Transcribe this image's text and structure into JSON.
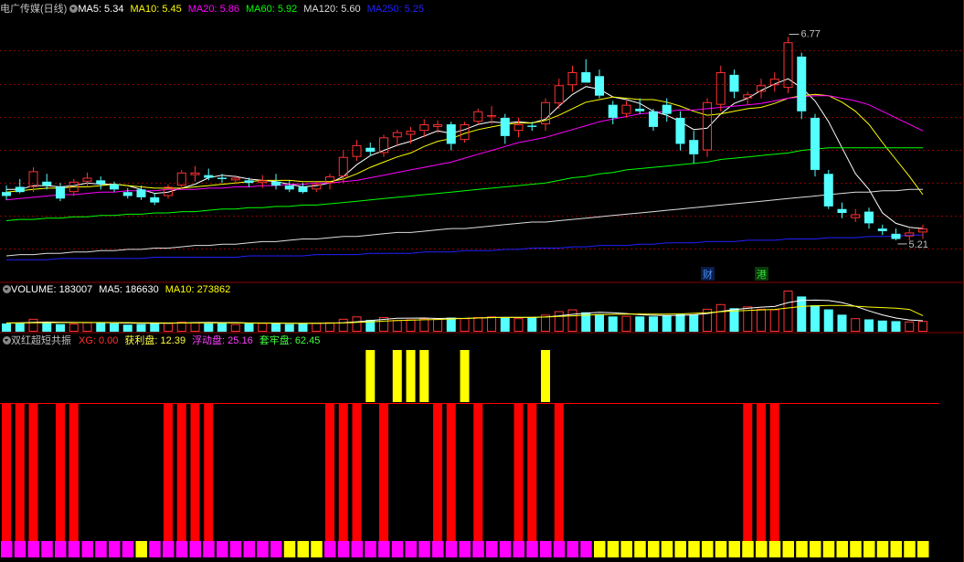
{
  "colors": {
    "up": "#ff3232",
    "down": "#54ffff",
    "ma5": "#ffffff",
    "ma10": "#ffff00",
    "ma20": "#ff00ff",
    "ma60": "#00ff00",
    "ma120": "#dddddd",
    "ma250": "#2020ff",
    "vol_ma5": "#ffffff",
    "vol_ma10": "#ffff00",
    "bar_red": "#ff0000",
    "bar_yellow": "#ffff00",
    "bar_magenta": "#ff00ff",
    "grid": "#8b0000",
    "label": "#c0c0c0"
  },
  "price_panel": {
    "stock_title": "电广传媒(日线)",
    "ma_labels": [
      {
        "name": "MA5",
        "value": "5.34",
        "color": "#ffffff"
      },
      {
        "name": "MA10",
        "value": "5.45",
        "color": "#ffff00"
      },
      {
        "name": "MA20",
        "value": "5.86",
        "color": "#ff00ff"
      },
      {
        "name": "MA60",
        "value": "5.92",
        "color": "#00ff00"
      },
      {
        "name": "MA120",
        "value": "5.60",
        "color": "#dddddd"
      },
      {
        "name": "MA250",
        "value": "5.25",
        "color": "#2020ff"
      }
    ],
    "high_label": "6.77",
    "low_label": "5.21",
    "event_tags": [
      {
        "text": "财",
        "color": "#4a8ff0",
        "bg": "#0a1d4a",
        "index": 52
      },
      {
        "text": "港",
        "color": "#30e030",
        "bg": "#0a3a0a",
        "index": 56
      }
    ]
  },
  "volume_panel": {
    "labels": [
      {
        "name": "VOLUME",
        "value": "183007",
        "color": "#ffffff"
      },
      {
        "name": "MA5",
        "value": "186630",
        "color": "#ffffff"
      },
      {
        "name": "MA10",
        "value": "273862",
        "color": "#ffff00"
      }
    ]
  },
  "indicator_panel": {
    "title": "双红超短共振",
    "labels": [
      {
        "name": "XG",
        "value": "0.00",
        "color": "#ff3030"
      },
      {
        "name": "获利盘",
        "value": "12.39",
        "color": "#ffff40"
      },
      {
        "name": "浮动盘",
        "value": "25.16",
        "color": "#ff40ff"
      },
      {
        "name": "套牢盘",
        "value": "62.45",
        "color": "#40ff40"
      }
    ]
  },
  "chart_data": {
    "type": "candlestick",
    "price_range": [
      4.95,
      6.9
    ],
    "candles": [
      [
        5.58,
        5.63,
        5.52,
        5.55
      ],
      [
        5.62,
        5.68,
        5.57,
        5.58
      ],
      [
        5.62,
        5.77,
        5.58,
        5.74
      ],
      [
        5.66,
        5.72,
        5.6,
        5.63
      ],
      [
        5.62,
        5.65,
        5.51,
        5.53
      ],
      [
        5.58,
        5.68,
        5.55,
        5.66
      ],
      [
        5.66,
        5.73,
        5.62,
        5.69
      ],
      [
        5.67,
        5.7,
        5.6,
        5.64
      ],
      [
        5.64,
        5.66,
        5.58,
        5.6
      ],
      [
        5.58,
        5.61,
        5.53,
        5.55
      ],
      [
        5.6,
        5.63,
        5.52,
        5.54
      ],
      [
        5.54,
        5.57,
        5.48,
        5.5
      ],
      [
        5.55,
        5.64,
        5.53,
        5.62
      ],
      [
        5.63,
        5.75,
        5.6,
        5.73
      ],
      [
        5.71,
        5.78,
        5.66,
        5.73
      ],
      [
        5.71,
        5.76,
        5.67,
        5.69
      ],
      [
        5.69,
        5.72,
        5.65,
        5.68
      ],
      [
        5.67,
        5.71,
        5.64,
        5.69
      ],
      [
        5.67,
        5.69,
        5.62,
        5.65
      ],
      [
        5.65,
        5.71,
        5.61,
        5.67
      ],
      [
        5.66,
        5.72,
        5.6,
        5.63
      ],
      [
        5.63,
        5.67,
        5.58,
        5.6
      ],
      [
        5.62,
        5.65,
        5.57,
        5.58
      ],
      [
        5.6,
        5.66,
        5.58,
        5.64
      ],
      [
        5.65,
        5.72,
        5.6,
        5.7
      ],
      [
        5.7,
        5.9,
        5.65,
        5.85
      ],
      [
        5.85,
        5.98,
        5.82,
        5.94
      ],
      [
        5.92,
        5.96,
        5.86,
        5.89
      ],
      [
        5.88,
        6.02,
        5.85,
        6.0
      ],
      [
        6.0,
        6.06,
        5.93,
        6.04
      ],
      [
        6.02,
        6.08,
        5.95,
        6.05
      ],
      [
        6.05,
        6.14,
        6.0,
        6.1
      ],
      [
        6.08,
        6.13,
        6.03,
        6.1
      ],
      [
        6.1,
        6.12,
        5.9,
        5.95
      ],
      [
        5.98,
        6.12,
        5.96,
        6.1
      ],
      [
        6.12,
        6.22,
        6.1,
        6.2
      ],
      [
        6.16,
        6.24,
        6.1,
        6.17
      ],
      [
        6.15,
        6.18,
        5.95,
        6.01
      ],
      [
        6.05,
        6.15,
        6.0,
        6.1
      ],
      [
        6.09,
        6.12,
        6.05,
        6.08
      ],
      [
        6.1,
        6.3,
        6.05,
        6.27
      ],
      [
        6.26,
        6.45,
        6.22,
        6.4
      ],
      [
        6.4,
        6.55,
        6.35,
        6.5
      ],
      [
        6.5,
        6.6,
        6.42,
        6.42
      ],
      [
        6.47,
        6.52,
        6.3,
        6.32
      ],
      [
        6.25,
        6.28,
        6.1,
        6.15
      ],
      [
        6.18,
        6.28,
        6.15,
        6.25
      ],
      [
        6.22,
        6.3,
        6.18,
        6.2
      ],
      [
        6.2,
        6.22,
        6.05,
        6.08
      ],
      [
        6.25,
        6.3,
        6.12,
        6.18
      ],
      [
        6.15,
        6.2,
        5.9,
        5.95
      ],
      [
        5.98,
        6.05,
        5.8,
        5.87
      ],
      [
        5.9,
        6.3,
        5.85,
        6.27
      ],
      [
        6.25,
        6.55,
        6.2,
        6.5
      ],
      [
        6.48,
        6.52,
        6.3,
        6.35
      ],
      [
        6.3,
        6.35,
        6.25,
        6.33
      ],
      [
        6.35,
        6.45,
        6.3,
        6.4
      ],
      [
        6.4,
        6.5,
        6.35,
        6.45
      ],
      [
        6.38,
        6.77,
        6.34,
        6.73
      ],
      [
        6.62,
        6.65,
        6.14,
        6.2
      ],
      [
        6.15,
        6.18,
        5.7,
        5.75
      ],
      [
        5.72,
        5.75,
        5.45,
        5.47
      ],
      [
        5.45,
        5.5,
        5.38,
        5.42
      ],
      [
        5.38,
        5.45,
        5.35,
        5.41
      ],
      [
        5.43,
        5.46,
        5.3,
        5.34
      ],
      [
        5.3,
        5.33,
        5.25,
        5.28
      ],
      [
        5.26,
        5.3,
        5.21,
        5.22
      ],
      [
        5.24,
        5.3,
        5.21,
        5.27
      ],
      [
        5.27,
        5.33,
        5.22,
        5.3
      ]
    ],
    "ma": {
      "MA5": [
        5.6,
        5.6,
        5.63,
        5.63,
        5.62,
        5.63,
        5.65,
        5.64,
        5.64,
        5.63,
        5.6,
        5.57,
        5.58,
        5.61,
        5.64,
        5.69,
        5.71,
        5.7,
        5.68,
        5.67,
        5.66,
        5.64,
        5.62,
        5.63,
        5.65,
        5.7,
        5.79,
        5.86,
        5.9,
        5.94,
        5.97,
        6.01,
        6.05,
        6.03,
        6.06,
        6.1,
        6.12,
        6.11,
        6.12,
        6.11,
        6.14,
        6.24,
        6.33,
        6.39,
        6.37,
        6.31,
        6.29,
        6.26,
        6.2,
        6.17,
        6.12,
        6.06,
        6.07,
        6.18,
        6.26,
        6.3,
        6.36,
        6.41,
        6.45,
        6.38,
        6.28,
        6.12,
        5.92,
        5.72,
        5.6,
        5.42,
        5.34,
        5.31,
        5.3
      ],
      "MA10": [
        5.58,
        5.59,
        5.6,
        5.61,
        5.61,
        5.62,
        5.62,
        5.63,
        5.64,
        5.63,
        5.62,
        5.61,
        5.61,
        5.61,
        5.62,
        5.63,
        5.64,
        5.65,
        5.66,
        5.67,
        5.67,
        5.67,
        5.66,
        5.66,
        5.66,
        5.68,
        5.72,
        5.77,
        5.81,
        5.85,
        5.88,
        5.93,
        5.97,
        5.99,
        6.03,
        6.06,
        6.08,
        6.1,
        6.11,
        6.11,
        6.13,
        6.17,
        6.22,
        6.27,
        6.29,
        6.31,
        6.3,
        6.29,
        6.29,
        6.27,
        6.24,
        6.2,
        6.17,
        6.18,
        6.2,
        6.22,
        6.23,
        6.26,
        6.3,
        6.32,
        6.33,
        6.32,
        6.27,
        6.2,
        6.1,
        5.96,
        5.83,
        5.7,
        5.56
      ],
      "MA20": [
        5.52,
        5.53,
        5.54,
        5.55,
        5.56,
        5.56,
        5.57,
        5.58,
        5.58,
        5.59,
        5.59,
        5.59,
        5.6,
        5.6,
        5.6,
        5.61,
        5.61,
        5.62,
        5.62,
        5.63,
        5.63,
        5.64,
        5.64,
        5.65,
        5.65,
        5.66,
        5.67,
        5.69,
        5.71,
        5.73,
        5.75,
        5.77,
        5.79,
        5.81,
        5.84,
        5.87,
        5.9,
        5.93,
        5.96,
        5.98,
        6.0,
        6.03,
        6.06,
        6.09,
        6.12,
        6.14,
        6.16,
        6.18,
        6.19,
        6.2,
        6.21,
        6.21,
        6.22,
        6.23,
        6.24,
        6.25,
        6.26,
        6.28,
        6.3,
        6.31,
        6.32,
        6.32,
        6.3,
        6.28,
        6.25,
        6.2,
        6.15,
        6.1,
        6.05
      ],
      "MA60": [
        5.36,
        5.37,
        5.37,
        5.38,
        5.38,
        5.39,
        5.39,
        5.4,
        5.4,
        5.41,
        5.41,
        5.42,
        5.42,
        5.43,
        5.43,
        5.44,
        5.45,
        5.45,
        5.46,
        5.46,
        5.47,
        5.47,
        5.48,
        5.48,
        5.49,
        5.5,
        5.51,
        5.52,
        5.53,
        5.54,
        5.55,
        5.56,
        5.57,
        5.58,
        5.59,
        5.6,
        5.61,
        5.62,
        5.63,
        5.64,
        5.65,
        5.67,
        5.69,
        5.7,
        5.72,
        5.73,
        5.75,
        5.76,
        5.77,
        5.78,
        5.79,
        5.8,
        5.81,
        5.83,
        5.84,
        5.85,
        5.86,
        5.87,
        5.88,
        5.9,
        5.91,
        5.92,
        5.92,
        5.92,
        5.92,
        5.92,
        5.92,
        5.92,
        5.92
      ],
      "MA120": [
        5.09,
        5.1,
        5.1,
        5.11,
        5.11,
        5.12,
        5.12,
        5.13,
        5.13,
        5.14,
        5.14,
        5.15,
        5.15,
        5.16,
        5.17,
        5.17,
        5.18,
        5.18,
        5.19,
        5.2,
        5.2,
        5.21,
        5.22,
        5.22,
        5.23,
        5.24,
        5.24,
        5.25,
        5.26,
        5.27,
        5.27,
        5.28,
        5.29,
        5.3,
        5.3,
        5.31,
        5.32,
        5.33,
        5.34,
        5.35,
        5.35,
        5.36,
        5.37,
        5.38,
        5.39,
        5.4,
        5.41,
        5.42,
        5.43,
        5.44,
        5.45,
        5.46,
        5.47,
        5.48,
        5.49,
        5.5,
        5.51,
        5.52,
        5.53,
        5.54,
        5.55,
        5.56,
        5.57,
        5.58,
        5.58,
        5.59,
        5.59,
        5.6,
        5.6
      ],
      "MA250": [
        5.06,
        5.06,
        5.06,
        5.06,
        5.07,
        5.07,
        5.07,
        5.07,
        5.07,
        5.07,
        5.07,
        5.08,
        5.08,
        5.08,
        5.08,
        5.08,
        5.08,
        5.08,
        5.09,
        5.09,
        5.09,
        5.09,
        5.09,
        5.1,
        5.1,
        5.1,
        5.1,
        5.11,
        5.11,
        5.11,
        5.11,
        5.12,
        5.12,
        5.12,
        5.13,
        5.13,
        5.13,
        5.14,
        5.14,
        5.15,
        5.15,
        5.15,
        5.16,
        5.16,
        5.17,
        5.17,
        5.17,
        5.18,
        5.18,
        5.19,
        5.19,
        5.19,
        5.2,
        5.2,
        5.2,
        5.21,
        5.21,
        5.21,
        5.22,
        5.22,
        5.22,
        5.23,
        5.23,
        5.23,
        5.24,
        5.24,
        5.24,
        5.25,
        5.25
      ]
    },
    "volume": {
      "range": [
        0,
        700000
      ],
      "values": [
        140,
        150,
        220,
        160,
        130,
        140,
        160,
        150,
        140,
        120,
        130,
        140,
        150,
        170,
        160,
        140,
        150,
        130,
        140,
        150,
        140,
        130,
        140,
        150,
        160,
        220,
        260,
        200,
        250,
        200,
        210,
        230,
        220,
        240,
        230,
        250,
        260,
        240,
        230,
        250,
        290,
        350,
        380,
        330,
        300,
        260,
        270,
        260,
        260,
        280,
        300,
        290,
        390,
        470,
        400,
        430,
        390,
        380,
        700,
        600,
        450,
        380,
        290,
        230,
        210,
        190,
        180,
        175,
        183
      ],
      "ma5": [
        150,
        152,
        160,
        165,
        162,
        158,
        156,
        155,
        150,
        148,
        145,
        143,
        145,
        150,
        155,
        158,
        156,
        155,
        150,
        148,
        146,
        143,
        142,
        143,
        146,
        154,
        170,
        190,
        210,
        228,
        231,
        234,
        226,
        230,
        226,
        234,
        243,
        244,
        242,
        242,
        250,
        270,
        296,
        316,
        330,
        324,
        310,
        290,
        280,
        276,
        278,
        288,
        310,
        346,
        378,
        398,
        418,
        430,
        496,
        534,
        538,
        530,
        496,
        432,
        354,
        286,
        234,
        200,
        187
      ],
      "ma10": [
        148,
        150,
        152,
        154,
        155,
        156,
        157,
        157,
        156,
        155,
        153,
        151,
        150,
        150,
        150,
        150,
        150,
        149,
        148,
        147,
        146,
        145,
        145,
        145,
        146,
        150,
        158,
        168,
        180,
        190,
        196,
        204,
        208,
        218,
        227,
        234,
        240,
        242,
        244,
        246,
        250,
        260,
        270,
        282,
        292,
        296,
        300,
        302,
        300,
        300,
        304,
        312,
        324,
        340,
        354,
        362,
        372,
        380,
        404,
        430,
        440,
        448,
        446,
        434,
        420,
        410,
        400,
        380,
        274
      ]
    },
    "xg_bars": [
      "R",
      "R",
      "R",
      null,
      "R",
      "R",
      null,
      null,
      null,
      null,
      null,
      null,
      "R",
      "R",
      "R",
      "R",
      null,
      null,
      null,
      null,
      null,
      null,
      null,
      null,
      "R",
      "R",
      "R",
      "Y",
      "R",
      "Y",
      "Y",
      "Y",
      "R",
      "R",
      "Y",
      "R",
      null,
      null,
      "R",
      "R",
      "Y",
      "R",
      null,
      null,
      null,
      null,
      null,
      null,
      null,
      null,
      null,
      null,
      null,
      null,
      null,
      "R",
      "R",
      "R",
      null,
      null,
      null,
      null,
      null,
      null,
      null,
      null,
      null,
      null,
      null
    ],
    "xg_bottom": [
      "M",
      "M",
      "M",
      "M",
      "M",
      "M",
      "M",
      "M",
      "M",
      "M",
      "Y",
      "M",
      "M",
      "M",
      "M",
      "M",
      "M",
      "M",
      "M",
      "M",
      "M",
      "Y",
      "Y",
      "Y",
      "M",
      "M",
      "M",
      "M",
      "M",
      "M",
      "M",
      "M",
      "M",
      "M",
      "M",
      "M",
      "M",
      "M",
      "M",
      "M",
      "M",
      "M",
      "M",
      "M",
      "Y",
      "Y",
      "Y",
      "Y",
      "Y",
      "Y",
      "Y",
      "Y",
      "Y",
      "Y",
      "Y",
      "Y",
      "Y",
      "Y",
      "Y",
      "Y",
      "Y",
      "Y",
      "Y",
      "Y",
      "Y",
      "Y",
      "Y",
      "Y",
      "Y"
    ]
  }
}
